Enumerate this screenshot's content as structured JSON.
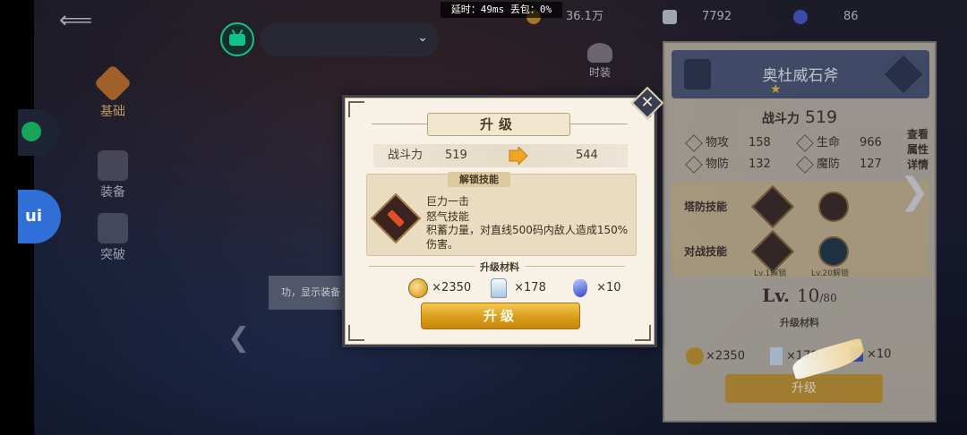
{
  "status_bar": {
    "latency": "延时：49ms 丢包：0%"
  },
  "resources": [
    {
      "name": "gold",
      "value": "36.1万"
    },
    {
      "name": "crystal",
      "value": "7792"
    },
    {
      "name": "gem",
      "value": "86"
    }
  ],
  "side_tabs": [
    {
      "label": "基础",
      "active": true
    },
    {
      "label": "装备",
      "active": false
    },
    {
      "label": "突破",
      "active": false
    }
  ],
  "outfit_label": "时装",
  "hint_text": "功，显示装备",
  "detail_panel": {
    "equip_name": "奥杜威石斧",
    "power_label": "战斗力",
    "power_value": "519",
    "stats": [
      {
        "key": "物攻",
        "value": "158"
      },
      {
        "key": "生命",
        "value": "966"
      },
      {
        "key": "物防",
        "value": "132"
      },
      {
        "key": "魔防",
        "value": "127"
      }
    ],
    "check_attr": "查看属性详情",
    "tower_skill": "塔防技能",
    "battle_skill": "对战技能",
    "skill_sub_1": "Lv.1解锁",
    "skill_sub_2": "Lv.20解锁",
    "level_prefix": "Lv.",
    "level_current": "10",
    "level_max": "/80",
    "materials_title": "升级材料",
    "mat_gold": "×2350",
    "mat_crystal": "×178",
    "mat_gem": "×10",
    "upgrade_label": "升级"
  },
  "modal": {
    "title": "升级",
    "power_label": "战斗力",
    "power_old": "519",
    "power_new": "544",
    "unlock_title": "解锁技能",
    "skill_name": "巨力一击",
    "skill_type": "怒气技能",
    "skill_desc": "积蓄力量，对直线500码内敌人造成150%伤害。",
    "materials_title": "升级材料",
    "materials": [
      {
        "icon": "gold-coin",
        "qty": "×2350"
      },
      {
        "icon": "crystal",
        "qty": "×178"
      },
      {
        "icon": "blue-gem",
        "qty": "×10"
      }
    ],
    "upgrade_button": "升级",
    "close_glyph": "✕"
  }
}
